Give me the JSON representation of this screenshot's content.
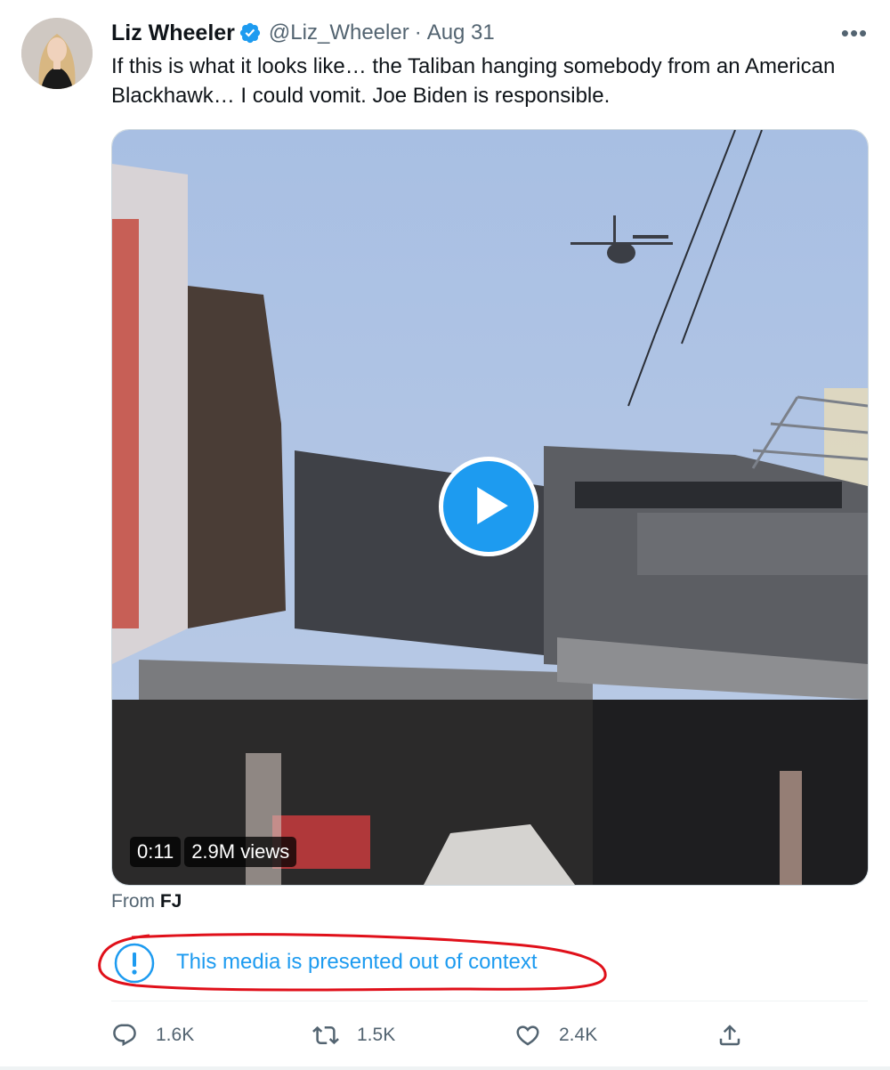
{
  "author": {
    "name": "Liz Wheeler",
    "handle": "@Liz_Wheeler",
    "separator": "·",
    "date": "Aug 31",
    "verified_icon": "verified-badge-icon",
    "avatar_icon": "avatar"
  },
  "more_icon_label": "•••",
  "tweet": {
    "text": "If this is what it looks like… the Taliban hanging somebody from an American Blackhawk… I could vomit. Joe Biden is responsible."
  },
  "media": {
    "duration": "0:11",
    "views": "2.9M views",
    "play_icon": "play-icon",
    "from_prefix": "From",
    "from_source": "FJ"
  },
  "context_note": {
    "label": "This media is presented out of context",
    "icon": "exclamation-circle-icon",
    "annotation_color": "#e0101a"
  },
  "actions": {
    "replies": "1.6K",
    "retweets": "1.5K",
    "likes": "2.4K",
    "reply_icon": "reply-icon",
    "retweet_icon": "retweet-icon",
    "like_icon": "heart-icon",
    "share_icon": "share-icon"
  },
  "colors": {
    "accent": "#1d9bf0",
    "text": "#0f1419",
    "secondary": "#536471"
  }
}
